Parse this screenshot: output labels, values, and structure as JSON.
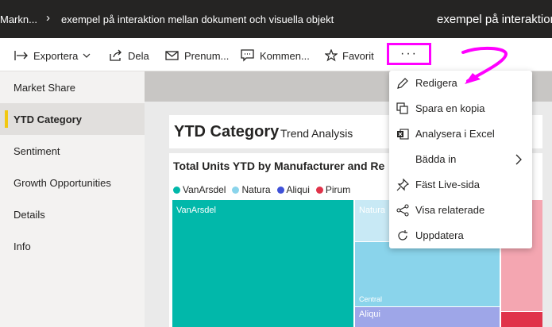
{
  "breadcrumb": {
    "first": "Markn...",
    "second": "exempel på interaktion mellan dokument och visuella objekt",
    "right_title": "exempel på interaktion"
  },
  "actions": {
    "export": "Exportera",
    "share": "Dela",
    "subscribe": "Prenum...",
    "comments": "Kommen...",
    "favorite": "Favorit",
    "more": "···"
  },
  "nav": {
    "items": [
      {
        "label": "Market Share",
        "active": false
      },
      {
        "label": "YTD Category",
        "active": true
      },
      {
        "label": "Sentiment",
        "active": false
      },
      {
        "label": "Growth Opportunities",
        "active": false
      },
      {
        "label": "Details",
        "active": false
      },
      {
        "label": "Info",
        "active": false
      }
    ]
  },
  "report": {
    "title": "YTD Category",
    "subtitle": "Trend Analysis",
    "visual_title": "Total Units YTD by Manufacturer and Re",
    "legend": [
      {
        "name": "VanArsdel",
        "color": "#01b8aa"
      },
      {
        "name": "Natura",
        "color": "#8ad4eb"
      },
      {
        "name": "Aliqui",
        "color": "#3f51d8"
      },
      {
        "name": "Pirum",
        "color": "#e0334a"
      }
    ],
    "treemap_labels": {
      "vanarsdel": "VanArsdel",
      "natura": "Natura",
      "central": "Central",
      "aliqui": "Aliqui"
    }
  },
  "menu": {
    "items": [
      {
        "label": "Redigera",
        "icon": "pencil-icon"
      },
      {
        "label": "Spara en kopia",
        "icon": "copy-icon"
      },
      {
        "label": "Analysera i Excel",
        "icon": "excel-icon"
      },
      {
        "label": "Bädda in",
        "icon": "",
        "submenu": true
      },
      {
        "label": "Fäst Live-sida",
        "icon": "pin-icon"
      },
      {
        "label": "Visa relaterade",
        "icon": "related-icon"
      },
      {
        "label": "Uppdatera",
        "icon": "refresh-icon"
      }
    ]
  },
  "colors": {
    "highlight": "#ff00ff",
    "active_marker": "#f2c811"
  }
}
